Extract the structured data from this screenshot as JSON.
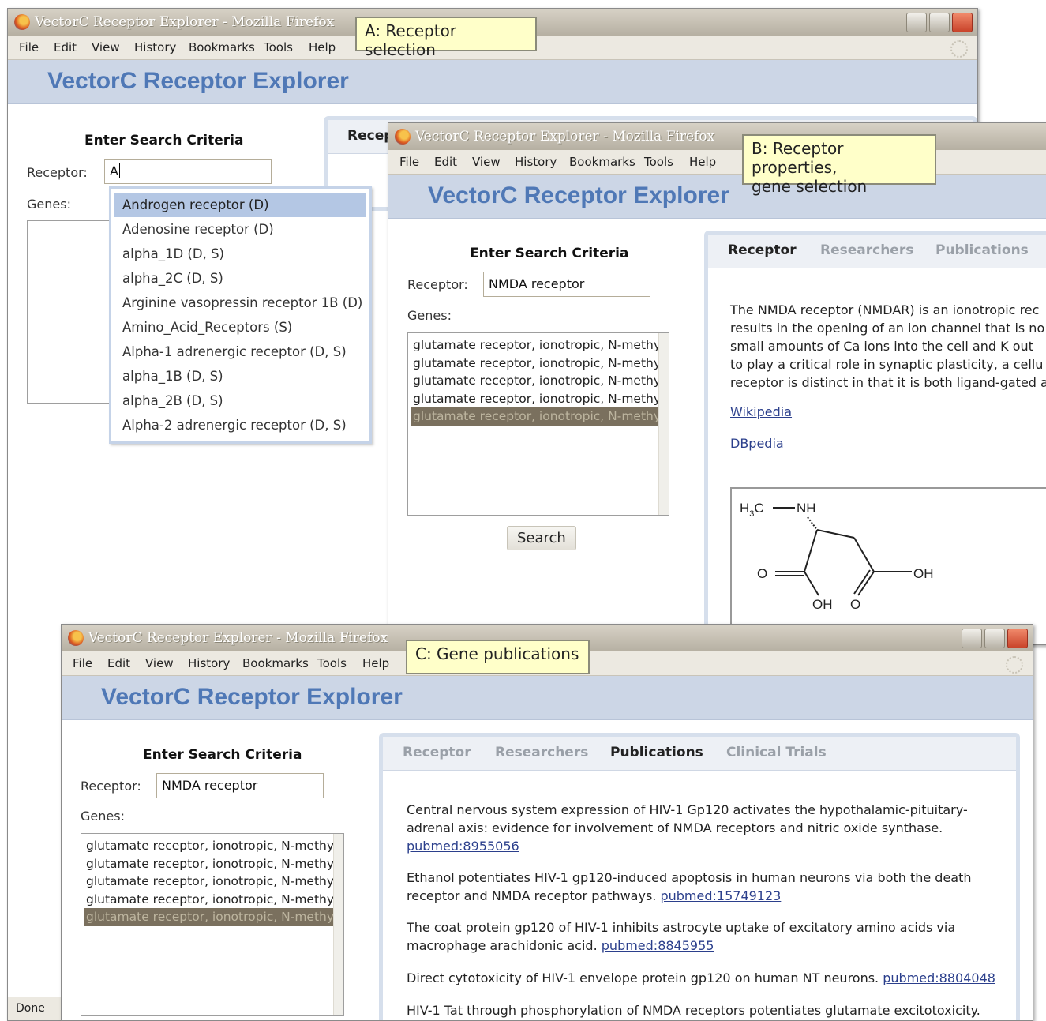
{
  "common": {
    "window_title": "VectorC Receptor Explorer - Mozilla Firefox",
    "menu": [
      "File",
      "Edit",
      "View",
      "History",
      "Bookmarks",
      "Tools",
      "Help"
    ],
    "app_title": "VectorC Receptor Explorer",
    "search_heading": "Enter Search Criteria",
    "receptor_label": "Receptor:",
    "genes_label": "Genes:"
  },
  "window_a": {
    "callout": "A: Receptor selection",
    "receptor_value": "A",
    "panel_tab_partial": "Recep",
    "autocomplete": [
      "Androgen receptor (D)",
      "Adenosine receptor (D)",
      "alpha_1D (D, S)",
      "alpha_2C (D, S)",
      "Arginine vasopressin receptor 1B (D)",
      "Amino_Acid_Receptors (S)",
      "Alpha-1 adrenergic receptor (D, S)",
      "alpha_1B (D, S)",
      "alpha_2B (D, S)",
      "Alpha-2 adrenergic receptor (D, S)"
    ],
    "highlighted_index": 0,
    "status": "Done"
  },
  "window_b": {
    "callout_line1": "B: Receptor properties,",
    "callout_line2": "gene selection",
    "receptor_value": "NMDA receptor",
    "genes": [
      "glutamate receptor, ionotropic, N-methyl",
      "glutamate receptor, ionotropic, N-methyl",
      "glutamate receptor, ionotropic, N-methyl",
      "glutamate receptor, ionotropic, N-methyl",
      "glutamate receptor, ionotropic, N-methyl"
    ],
    "selected_gene_index": 4,
    "search_button": "Search",
    "tabs": [
      "Receptor",
      "Researchers",
      "Publications"
    ],
    "active_tab": "Receptor",
    "description_lines": [
      "The NMDA receptor (NMDAR) is an ionotropic rec",
      "results in the opening of an ion channel that is no",
      "small amounts of Ca ions into the cell and K out",
      "to play a critical role in synaptic plasticity, a cellu",
      "receptor is distinct in that it is both ligand-gated a"
    ],
    "links": [
      "Wikipedia",
      "DBpedia"
    ],
    "molecule_labels": {
      "h3c": "H",
      "nh": "NH",
      "o_left": "O",
      "oh_right": "OH",
      "oh_bottom": "OH",
      "o_bottom": "O"
    }
  },
  "window_c": {
    "callout": "C: Gene publications",
    "receptor_value": "NMDA receptor",
    "genes": [
      "glutamate receptor, ionotropic, N-methyl",
      "glutamate receptor, ionotropic, N-methyl",
      "glutamate receptor, ionotropic, N-methyl",
      "glutamate receptor, ionotropic, N-methyl",
      "glutamate receptor, ionotropic, N-methyl"
    ],
    "selected_gene_index": 4,
    "tabs": [
      "Receptor",
      "Researchers",
      "Publications",
      "Clinical Trials"
    ],
    "active_tab": "Publications",
    "publications": [
      {
        "lines": [
          "Central nervous system expression of HIV-1 Gp120 activates the hypothalamic-pituitary-",
          "adrenal axis: evidence for involvement of NMDA receptors and nitric oxide synthase."
        ],
        "prefix": "",
        "link": "pubmed:8955056"
      },
      {
        "lines": [
          "Ethanol potentiates HIV-1 gp120-induced apoptosis in human neurons via both the death"
        ],
        "prefix": "receptor and NMDA receptor pathways.",
        "link": "pubmed:15749123"
      },
      {
        "lines": [
          "The coat protein gp120 of HIV-1 inhibits astrocyte uptake of excitatory amino acids via"
        ],
        "prefix": "macrophage arachidonic acid.",
        "link": "pubmed:8845955"
      },
      {
        "lines": [],
        "prefix": "Direct cytotoxicity of HIV-1 envelope protein gp120 on human NT neurons.",
        "link": "pubmed:8804048"
      },
      {
        "lines": [
          "HIV-1 Tat through phosphorylation of NMDA receptors potentiates glutamate excitotoxicity."
        ],
        "prefix": "",
        "link": ""
      }
    ]
  }
}
